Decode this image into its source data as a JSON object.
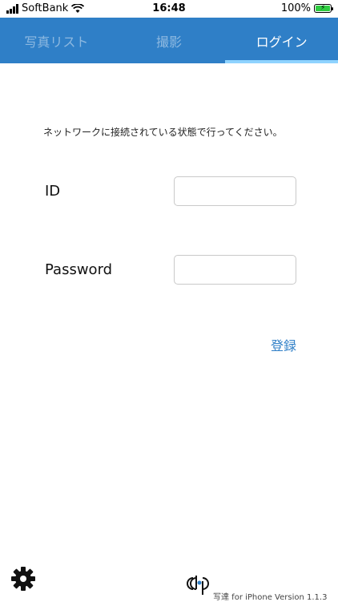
{
  "status_bar": {
    "carrier": "SoftBank",
    "time": "16:48",
    "battery": "100%"
  },
  "tabs": [
    {
      "label": "写真リスト",
      "active": false
    },
    {
      "label": "撮影",
      "active": false
    },
    {
      "label": "ログイン",
      "active": true
    }
  ],
  "login": {
    "notice": "ネットワークに接続されている状態で行ってください。",
    "id_label": "ID",
    "id_value": "",
    "password_label": "Password",
    "password_value": "",
    "register_label": "登録"
  },
  "footer": {
    "version_text": "写達 for iPhone Version 1.1.3"
  },
  "colors": {
    "accent": "#2f7fc7",
    "tab_indicator": "#8fd3ff",
    "battery": "#2ecc40"
  },
  "icons": {
    "settings": "gear-icon",
    "app_logo": "app-logo-icon"
  }
}
